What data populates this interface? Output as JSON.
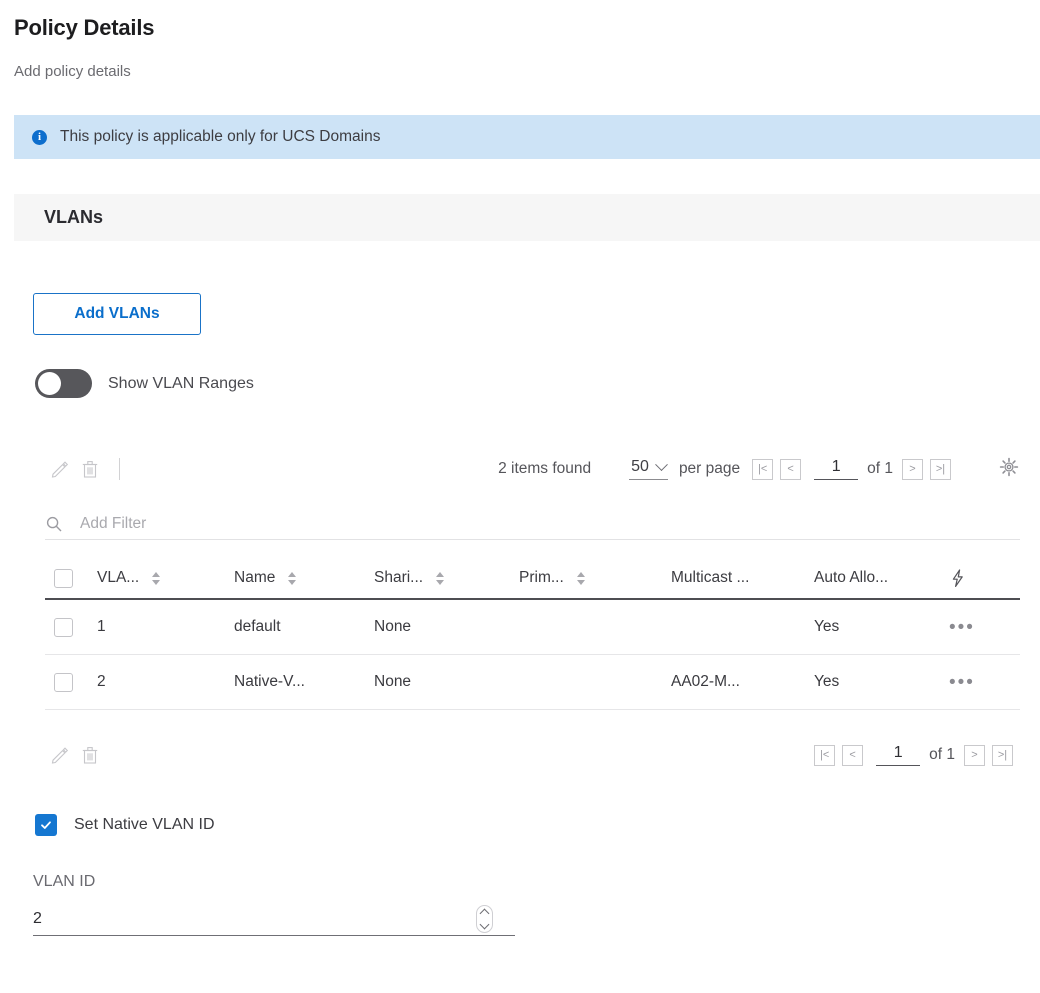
{
  "header": {
    "title": "Policy Details",
    "subtitle": "Add policy details"
  },
  "banner": {
    "icon": "info-icon",
    "glyph": "i",
    "text": "This policy is applicable only for UCS Domains",
    "background_color": "#cde3f6",
    "icon_color": "#0d6ecd"
  },
  "section": {
    "title": "VLANs",
    "background_color": "#f6f6f6"
  },
  "actions": {
    "add_vlans_label": "Add VLANs",
    "accent_color": "#0a6ecb"
  },
  "toggle": {
    "label": "Show VLAN Ranges",
    "state": "off",
    "track_color": "#57575b"
  },
  "toolbar": {
    "edit_icon": "pencil-icon",
    "delete_icon": "trash-icon",
    "items_found": "2 items found",
    "per_page_value": "50",
    "per_page_label": "per page",
    "first_page_glyph": "|<",
    "prev_page_glyph": "<",
    "next_page_glyph": ">",
    "last_page_glyph": ">|",
    "current_page": "1",
    "of_pages": "of 1",
    "settings_icon": "gear-icon"
  },
  "filter": {
    "icon": "search-icon",
    "placeholder": "Add Filter",
    "value": ""
  },
  "table": {
    "columns": [
      {
        "label": "VLA...",
        "sortable": true
      },
      {
        "label": "Name",
        "sortable": true
      },
      {
        "label": "Shari...",
        "sortable": true
      },
      {
        "label": "Prim...",
        "sortable": true
      },
      {
        "label": "Multicast ...",
        "sortable": false
      },
      {
        "label": "Auto Allo...",
        "sortable": false
      }
    ],
    "action_column_icon": "lightning-bolt-icon",
    "rows": [
      {
        "vlan_id": "1",
        "name": "default",
        "sharing": "None",
        "primary": "",
        "multicast": "",
        "auto_allow": "Yes",
        "menu": "•••"
      },
      {
        "vlan_id": "2",
        "name": "Native-V...",
        "sharing": "None",
        "primary": "",
        "multicast": "AA02-M...",
        "auto_allow": "Yes",
        "menu": "•••"
      }
    ]
  },
  "bottom_toolbar": {
    "edit_icon": "pencil-icon",
    "delete_icon": "trash-icon",
    "first_page_glyph": "|<",
    "prev_page_glyph": "<",
    "next_page_glyph": ">",
    "last_page_glyph": ">|",
    "current_page": "1",
    "of_pages": "of 1"
  },
  "native_vlan": {
    "checkbox_label": "Set Native VLAN ID",
    "checked": true,
    "checkbox_color": "#1577d1"
  },
  "vlan_id_field": {
    "label": "VLAN ID",
    "value": "2",
    "stepper_up_icon": "chevron-up-icon",
    "stepper_down_icon": "chevron-down-icon"
  }
}
